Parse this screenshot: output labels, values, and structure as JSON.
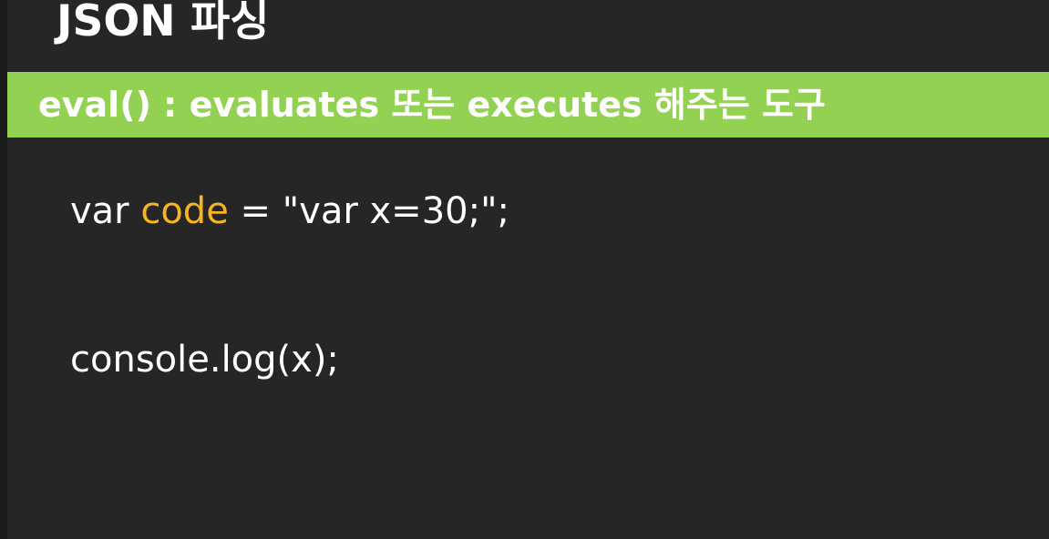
{
  "slide": {
    "title": "JSON 파싱",
    "banner": "eval() : evaluates 또는 executes 해주는 도구",
    "code": {
      "line1": {
        "prefix": "var ",
        "highlight": "code",
        "suffix": " = \"var x=30;\";"
      },
      "line2": "console.log(x);"
    }
  },
  "colors": {
    "background": "#262626",
    "banner": "#93d152",
    "highlight": "#f7b41e",
    "text": "#ffffff"
  }
}
